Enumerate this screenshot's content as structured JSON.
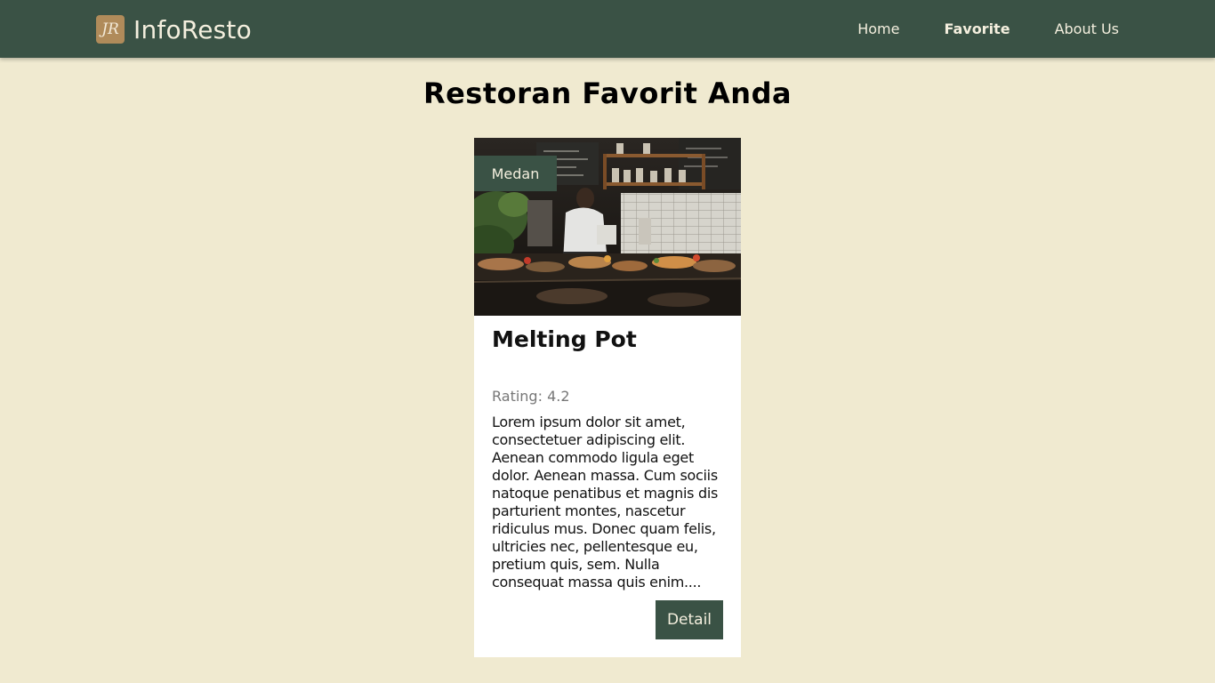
{
  "navbar": {
    "logo_text": "JR",
    "brand": "InfoResto",
    "links": [
      {
        "label": "Home"
      },
      {
        "label": "Favorite"
      },
      {
        "label": "About Us"
      }
    ]
  },
  "page": {
    "title": "Restoran Favorit Anda"
  },
  "restaurants": [
    {
      "city": "Medan",
      "name": "Melting Pot",
      "rating": "Rating: 4.2",
      "description": "Lorem ipsum dolor sit amet, consectetuer adipiscing elit. Aenean commodo ligula eget dolor. Aenean massa. Cum sociis natoque penatibus et magnis dis parturient montes, nascetur ridiculus mus. Donec quam felis, ultricies nec, pellentesque eu, pretium quis, sem. Nulla consequat massa quis enim....",
      "detail_label": "Detail"
    }
  ],
  "colors": {
    "navbar": "#3a5245",
    "background": "#f0ead0",
    "accent_logo": "#b08b5a"
  }
}
